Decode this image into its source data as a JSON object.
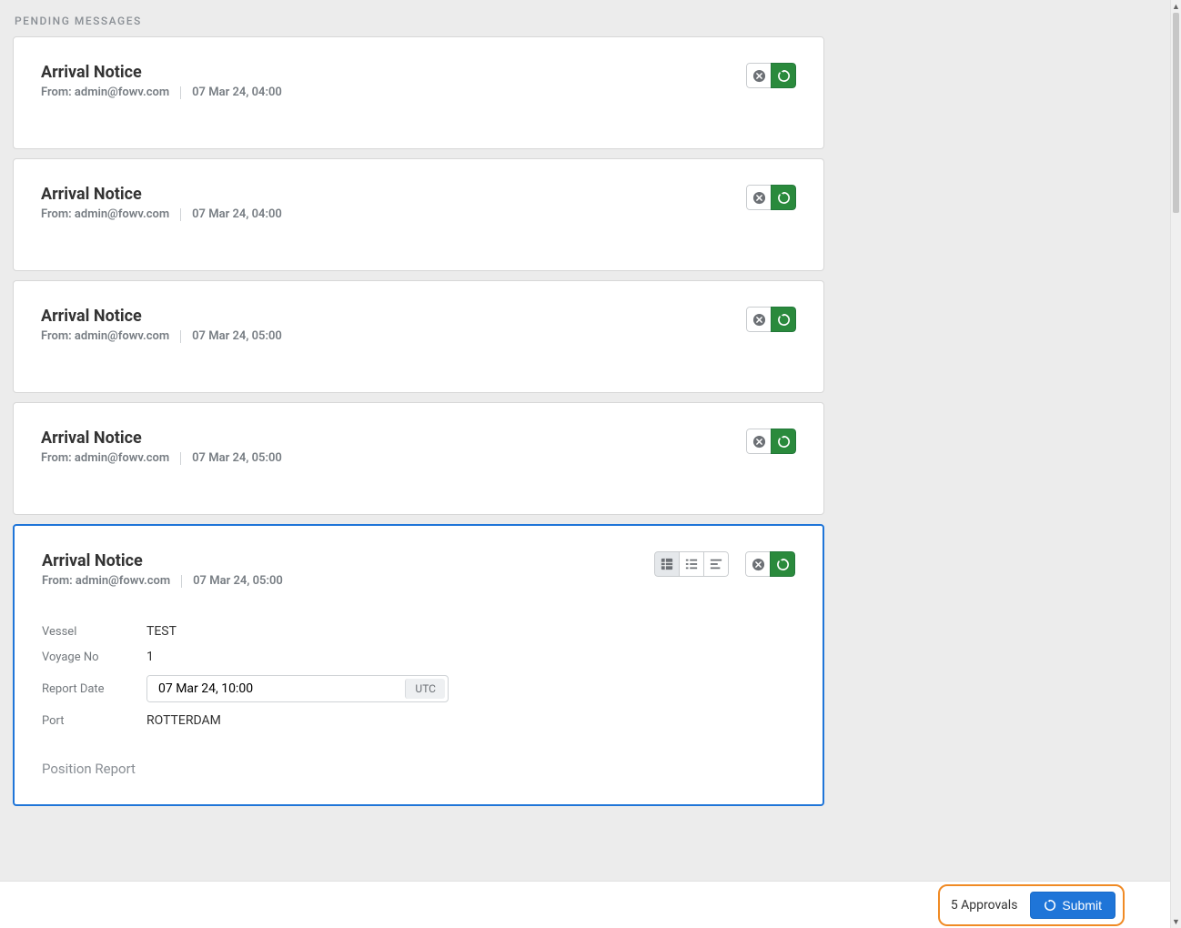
{
  "section_label": "PENDING MESSAGES",
  "messages": [
    {
      "title": "Arrival Notice",
      "from": "From: admin@fowv.com",
      "date": "07 Mar 24, 04:00"
    },
    {
      "title": "Arrival Notice",
      "from": "From: admin@fowv.com",
      "date": "07 Mar 24, 04:00"
    },
    {
      "title": "Arrival Notice",
      "from": "From: admin@fowv.com",
      "date": "07 Mar 24, 05:00"
    },
    {
      "title": "Arrival Notice",
      "from": "From: admin@fowv.com",
      "date": "07 Mar 24, 05:00"
    }
  ],
  "selected": {
    "title": "Arrival Notice",
    "from": "From: admin@fowv.com",
    "date": "07 Mar 24, 05:00",
    "fields": {
      "vessel_label": "Vessel",
      "vessel_value": "TEST",
      "voyage_label": "Voyage No",
      "voyage_value": "1",
      "reportdate_label": "Report Date",
      "reportdate_value": "07 Mar 24, 10:00",
      "reportdate_suffix": "UTC",
      "port_label": "Port",
      "port_value": "ROTTERDAM"
    },
    "subsection": "Position Report"
  },
  "footer": {
    "approvals": "5 Approvals",
    "submit": "Submit"
  }
}
